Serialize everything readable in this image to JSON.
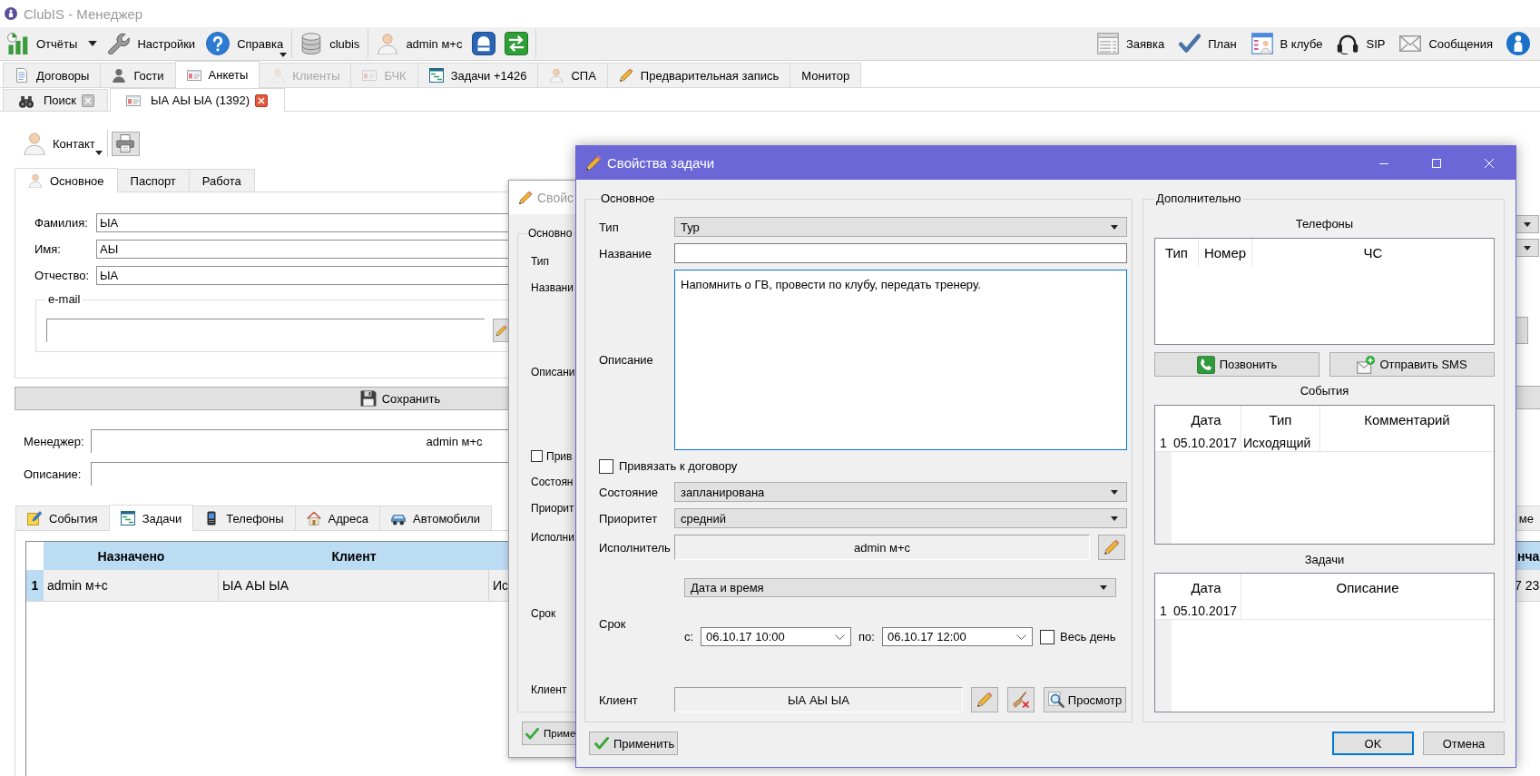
{
  "window": {
    "title": "ClubIS - Менеджер"
  },
  "toolbar": {
    "groups": [
      {
        "items": [
          {
            "kind": "split",
            "label": "Отчёты"
          },
          {
            "kind": "button",
            "label": "Настройки"
          },
          {
            "kind": "menu",
            "label": "Справка"
          }
        ]
      },
      {
        "items": [
          {
            "kind": "button",
            "label": "clubis"
          }
        ]
      },
      {
        "items": [
          {
            "kind": "button",
            "label": "admin м+с"
          },
          {
            "kind": "icon"
          },
          {
            "kind": "icon"
          }
        ]
      }
    ],
    "right_items": [
      {
        "kind": "button",
        "label": "Заявка"
      },
      {
        "kind": "button",
        "label": "План"
      },
      {
        "kind": "button",
        "label": "В клубе"
      },
      {
        "kind": "button",
        "label": "SIP"
      },
      {
        "kind": "button",
        "label": "Сообщения"
      },
      {
        "kind": "icon"
      }
    ]
  },
  "module_tabs": [
    {
      "label": "Договоры",
      "selected": false,
      "disabled": false
    },
    {
      "label": "Гости",
      "selected": false,
      "disabled": false
    },
    {
      "label": "Анкеты",
      "selected": true,
      "disabled": false
    },
    {
      "label": "Клиенты",
      "selected": false,
      "disabled": true
    },
    {
      "label": "БЧК",
      "selected": false,
      "disabled": true
    },
    {
      "label": "Задачи +1426",
      "selected": false,
      "disabled": false
    },
    {
      "label": "СПА",
      "selected": false,
      "disabled": false
    },
    {
      "label": "Предварительная запись",
      "selected": false,
      "disabled": false
    },
    {
      "label": "Монитор",
      "selected": false,
      "disabled": false
    }
  ],
  "document_tabs": [
    {
      "label": "Поиск",
      "selected": false
    },
    {
      "label": "ЫА АЫ ЫА (1392)",
      "selected": true
    }
  ],
  "card": {
    "contact_button": "Контакт",
    "tabs": [
      {
        "label": "Основное",
        "selected": true
      },
      {
        "label": "Паспорт",
        "selected": false
      },
      {
        "label": "Работа",
        "selected": false
      }
    ],
    "fields": [
      {
        "label": "Фамилия:",
        "value": "ЫА"
      },
      {
        "label": "Имя:",
        "value": "АЫ"
      },
      {
        "label": "Отчество:",
        "value": "ЫА"
      }
    ],
    "email_group": {
      "title": "e-mail"
    },
    "save_button": "Сохранить",
    "manager": {
      "label": "Менеджер:",
      "value": "admin м+с"
    },
    "description": {
      "label": "Описание:"
    },
    "detail_tabs": [
      {
        "label": "События",
        "selected": false
      },
      {
        "label": "Задачи",
        "selected": true
      },
      {
        "label": "Телефоны",
        "selected": false
      },
      {
        "label": "Адреса",
        "selected": false
      },
      {
        "label": "Автомобили",
        "selected": false
      },
      {
        "label": "ме",
        "selected": false
      }
    ],
    "tasks_table": {
      "columns": [
        {
          "title": "Назначено"
        },
        {
          "title": "Клиент"
        },
        {},
        {
          "title": "нча"
        }
      ],
      "rows": [
        {
          "number": "1",
          "selected": true,
          "cells": [
            "admin м+с",
            "ЫА АЫ ЫА",
            "Ис",
            "7 23"
          ]
        }
      ]
    }
  },
  "back_dialog": {
    "title": "Свойс",
    "group_title": "Основно",
    "rows": [
      {
        "kind": "combo",
        "label": "Тип"
      },
      {
        "kind": "text",
        "label": "Названи"
      },
      {
        "kind": "memo",
        "label": "Описани"
      },
      {
        "kind": "checkbox",
        "label": "Прив",
        "checked": false
      },
      {
        "kind": "combo",
        "label": "Состоян"
      },
      {
        "kind": "combo",
        "label": "Приорит"
      },
      {
        "kind": "picker",
        "label": "Исполни"
      },
      {
        "kind": "term",
        "label": "Срок"
      },
      {
        "kind": "client",
        "label": "Клиент"
      }
    ],
    "apply_button": "Приме"
  },
  "dialog": {
    "title": "Свойства задачи",
    "main_group": {
      "title": "Основное",
      "rows": [
        {
          "kind": "combo",
          "label": "Тип",
          "value": "Тур"
        },
        {
          "kind": "text",
          "label": "Название"
        },
        {
          "kind": "memo",
          "label": "Описание",
          "value": "Напомнить о ГВ, провести по клубу, передать тренеру.",
          "focused": true
        },
        {
          "kind": "checkbox",
          "label": "Привязать к договору",
          "checked": false
        },
        {
          "kind": "combo",
          "label": "Состояние",
          "value": "запланирована"
        },
        {
          "kind": "combo",
          "label": "Приоритет",
          "value": "средний"
        },
        {
          "kind": "picker",
          "label": "Исполнитель",
          "value": "admin м+с"
        },
        {
          "kind": "term",
          "label": "Срок",
          "mode": "Дата и время",
          "from_label": "с:",
          "from": "06.10.17 10:00",
          "to_label": "по:",
          "to": "06.10.17 12:00",
          "all_day": {
            "label": "Весь день",
            "checked": false
          }
        },
        {
          "kind": "client",
          "label": "Клиент",
          "value": "ЫА АЫ ЫА",
          "view_button": "Просмотр"
        }
      ]
    },
    "extra_group": {
      "title": "Дополнительно",
      "phones": {
        "title": "Телефоны",
        "columns": [
          "Тип",
          "Номер",
          "ЧС"
        ]
      },
      "call_button": "Позвонить",
      "sms_button": "Отправить SMS",
      "events": {
        "title": "События",
        "columns": [
          "Дата",
          "Тип",
          "Комментарий"
        ],
        "rows": [
          {
            "number": "1",
            "cells": [
              "05.10.2017",
              "Исходящий"
            ]
          }
        ]
      },
      "tasks": {
        "title": "Задачи",
        "columns": [
          "Дата",
          "Описание"
        ],
        "rows": [
          {
            "number": "1",
            "cells": [
              "05.10.2017"
            ]
          }
        ]
      }
    },
    "apply_button": "Применить",
    "ok_button": "OK",
    "cancel_button": "Отмена"
  }
}
